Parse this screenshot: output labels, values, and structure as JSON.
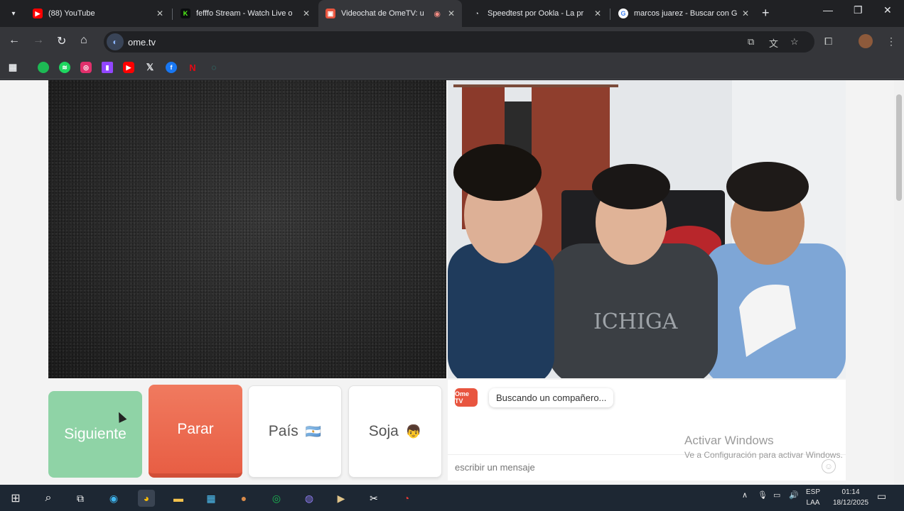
{
  "tabs": [
    {
      "title": "(88) YouTube",
      "favicon": "youtube-icon",
      "color": "#ff0000"
    },
    {
      "title": "fefffo Stream - Watch Live o",
      "favicon": "kick-icon",
      "color": "#53fc18"
    },
    {
      "title": "Videochat de OmeTV: u",
      "favicon": "ometv-icon",
      "color": "#e8553f"
    },
    {
      "title": "Speedtest por Ookla - La pr",
      "favicon": "speedtest-icon",
      "color": "#ffffff"
    },
    {
      "title": "marcos juarez - Buscar con G",
      "favicon": "google-icon",
      "color": "#4285f4"
    }
  ],
  "address": {
    "url": "ome.tv"
  },
  "bookmarks": [
    {
      "name": "spotify-green-icon",
      "color": "#1db954"
    },
    {
      "name": "spotify-icon",
      "color": "#1ed760"
    },
    {
      "name": "instagram-icon",
      "color": "#e1306c"
    },
    {
      "name": "twitch-icon",
      "color": "#9146ff"
    },
    {
      "name": "youtube-icon",
      "color": "#ff0000"
    },
    {
      "name": "x-icon",
      "color": "#000000"
    },
    {
      "name": "facebook-icon",
      "color": "#1877f2"
    },
    {
      "name": "netflix-icon",
      "color": "#e50914"
    },
    {
      "name": "tradingview-icon",
      "color": "#2a9d8f"
    }
  ],
  "controls": {
    "next_label": "Siguiente",
    "stop_label": "Parar",
    "country_label": "País",
    "country_flag": "🇦🇷",
    "gender_label": "Soja",
    "gender_emoji": "👦"
  },
  "chat": {
    "logo_text": "Ome TV",
    "status_message": "Buscando un compañero...",
    "input_placeholder": "escribir un mensaje"
  },
  "watermark": {
    "title": "Activar Windows",
    "subtitle": "Ve a Configuración para activar Windows."
  },
  "system_tray": {
    "lang_line1": "ESP",
    "lang_line2": "LAA",
    "time": "01:14",
    "date": "18/12/2025"
  },
  "colors": {
    "next_button": "#8fd3a6",
    "stop_button": "#e85e44",
    "taskbar": "#1d2733"
  }
}
